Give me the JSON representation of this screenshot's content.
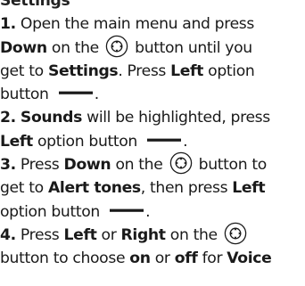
{
  "heading_clip": "Settings",
  "steps": [
    {
      "number": "1.",
      "lines": [
        {
          "t1": "Open the main menu and press"
        },
        {
          "b1": "Down",
          "t1": " on the ",
          "icon": "nav-key",
          "t2": " button until you"
        },
        {
          "t1": "get to ",
          "b1": "Settings",
          "t2": ". Press ",
          "b2": "Left",
          "t3": " option"
        },
        {
          "t1": "button ",
          "icon": "option-button-line",
          "t2": "."
        }
      ]
    },
    {
      "number": "2.",
      "lines": [
        {
          "b1": "Sounds",
          "t1": " will be highlighted, press"
        },
        {
          "b1": "Left",
          "t1": " option button ",
          "icon": "option-button-line",
          "t2": "."
        }
      ]
    },
    {
      "number": "3.",
      "lines": [
        {
          "t1": "Press ",
          "b1": "Down",
          "t2": " on the ",
          "icon": "nav-key",
          "t3": " button to"
        },
        {
          "t1": "get to ",
          "b1": "Alert tones",
          "t2": ", then press ",
          "b2": "Left"
        },
        {
          "t1": "option button ",
          "icon": "option-button-line",
          "t2": "."
        }
      ]
    },
    {
      "number": "4.",
      "lines": [
        {
          "t1": "Press ",
          "b1": "Left",
          "t2": " or ",
          "b2": "Right",
          "t3": " on the ",
          "icon": "nav-key"
        },
        {
          "t1": "button to choose ",
          "b1": "on",
          "t2": " or ",
          "b2": "off",
          "t3": " for ",
          "b3": "Voice"
        }
      ]
    }
  ]
}
